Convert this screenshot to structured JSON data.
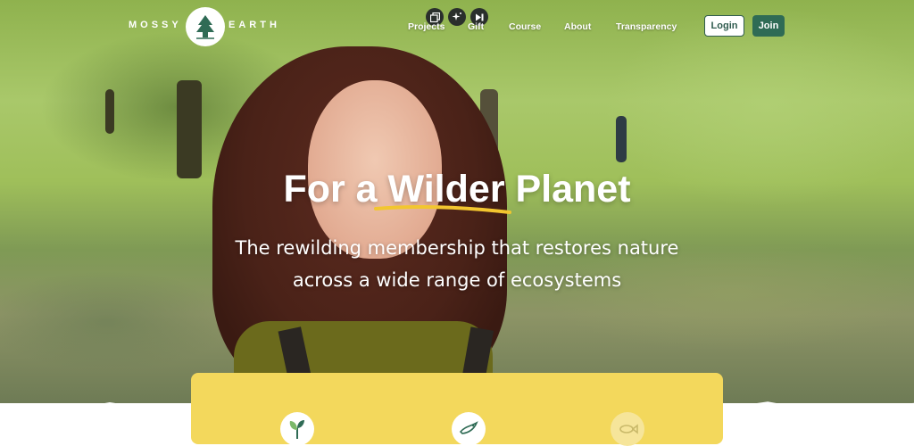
{
  "brand": {
    "name_left": "MOSSY",
    "name_right": "EARTH",
    "logo_icon": "pine-tree-icon"
  },
  "nav": {
    "items": [
      {
        "label": "Projects"
      },
      {
        "label": "Gift"
      },
      {
        "label": "Course"
      },
      {
        "label": "About"
      },
      {
        "label": "Transparency"
      }
    ],
    "quick_icons": [
      "gallery-icon",
      "sparkle-icon",
      "video-icon"
    ],
    "login_label": "Login",
    "join_label": "Join"
  },
  "hero": {
    "title_prefix": "For a ",
    "title_highlight": "Wilder",
    "title_suffix": " Planet",
    "subtitle_line1": "The rewilding membership that restores nature",
    "subtitle_line2": "across a wide range of ecosystems"
  },
  "card": {
    "icons": [
      "seedling-icon",
      "bird-icon",
      "fish-icon"
    ]
  },
  "colors": {
    "brand_green": "#2f6b55",
    "accent_yellow": "#f3d85c",
    "swoosh": "#f2c62f"
  }
}
